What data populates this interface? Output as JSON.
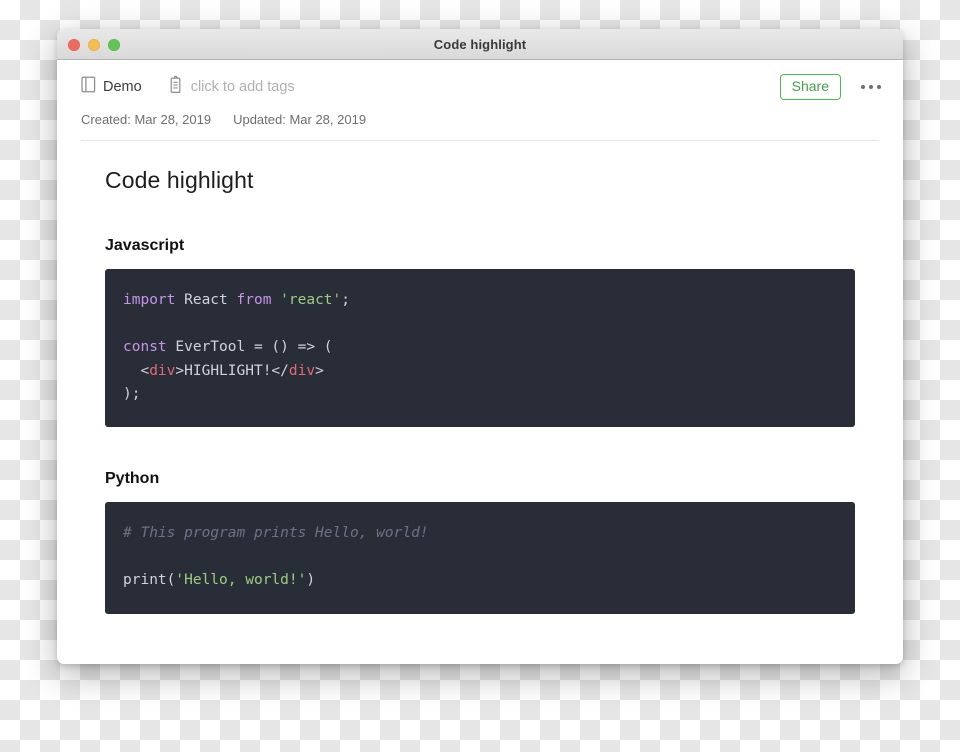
{
  "window": {
    "title": "Code highlight",
    "traffic_lights": [
      {
        "name": "close",
        "color": "#ef6b5f"
      },
      {
        "name": "minimize",
        "color": "#f4bd4f"
      },
      {
        "name": "zoom",
        "color": "#61c454"
      }
    ]
  },
  "toolbar": {
    "notebook_icon": "notebook-icon",
    "notebook_name": "Demo",
    "tag_icon": "tag-icon",
    "tag_placeholder": "click to add tags",
    "share_label": "Share",
    "share_accent": "#4fb850",
    "more_icon": "ellipsis-icon"
  },
  "meta": {
    "created": "Created: Mar 28, 2019",
    "updated": "Updated: Mar 28, 2019"
  },
  "note": {
    "title": "Code highlight",
    "sections": [
      {
        "heading": "Javascript",
        "code_lines": [
          [
            {
              "t": "import",
              "c": "kw"
            },
            {
              "t": " React ",
              "c": "plain"
            },
            {
              "t": "from",
              "c": "kw"
            },
            {
              "t": " ",
              "c": "plain"
            },
            {
              "t": "'react'",
              "c": "str"
            },
            {
              "t": ";",
              "c": "plain"
            }
          ],
          [],
          [
            {
              "t": "const",
              "c": "kw"
            },
            {
              "t": " EverTool = () => (",
              "c": "plain"
            }
          ],
          [
            {
              "t": "  <",
              "c": "plain"
            },
            {
              "t": "div",
              "c": "tag"
            },
            {
              "t": ">HIGHLIGHT!</",
              "c": "plain"
            },
            {
              "t": "div",
              "c": "tag"
            },
            {
              "t": ">",
              "c": "plain"
            }
          ],
          [
            {
              "t": ");",
              "c": "plain"
            }
          ]
        ]
      },
      {
        "heading": "Python",
        "code_lines": [
          [
            {
              "t": "# This program prints Hello, world!",
              "c": "cmt"
            }
          ],
          [],
          [
            {
              "t": "print(",
              "c": "plain"
            },
            {
              "t": "'Hello, world!'",
              "c": "str"
            },
            {
              "t": ")",
              "c": "plain"
            }
          ]
        ]
      }
    ]
  },
  "theme": {
    "code_bg": "#292d38",
    "code_fg": "#cfd3dc",
    "keyword": "#c792ea",
    "string": "#9cce80",
    "tag": "#e4686f",
    "comment": "#6b7285"
  }
}
